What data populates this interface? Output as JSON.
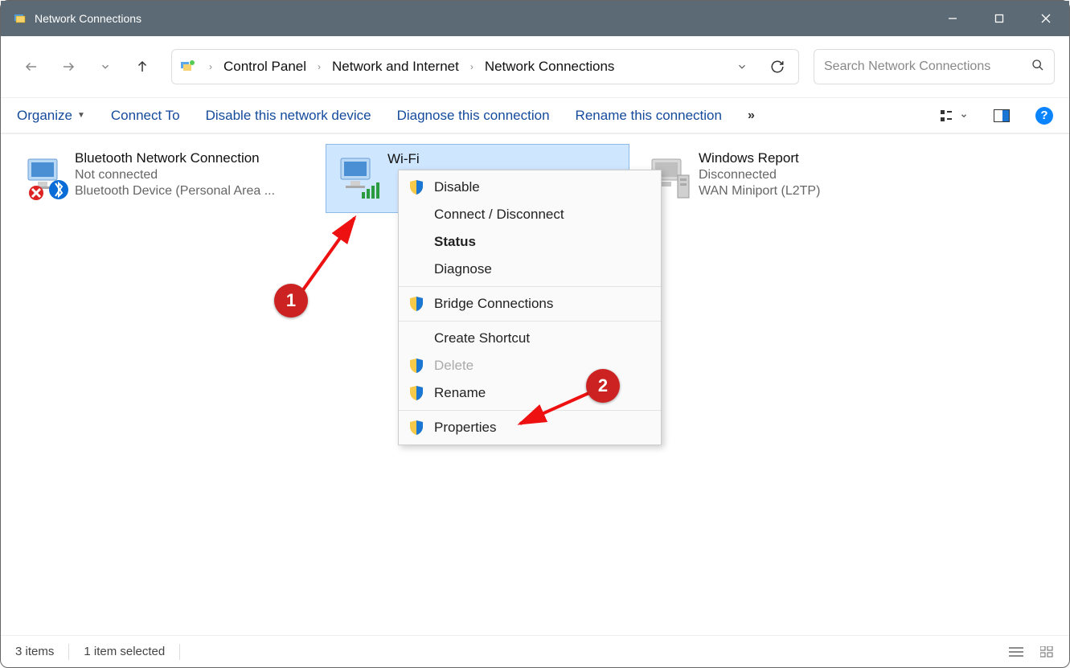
{
  "window": {
    "title": "Network Connections"
  },
  "breadcrumb": {
    "root": "Control Panel",
    "mid": "Network and Internet",
    "leaf": "Network Connections"
  },
  "search": {
    "placeholder": "Search Network Connections"
  },
  "cmd": {
    "organize": "Organize",
    "connect": "Connect To",
    "disable": "Disable this network device",
    "diagnose": "Diagnose this connection",
    "rename": "Rename this connection"
  },
  "items": [
    {
      "name": "Bluetooth Network Connection",
      "status": "Not connected",
      "device": "Bluetooth Device (Personal Area ..."
    },
    {
      "name": "Wi-Fi",
      "status": "",
      "device": ""
    },
    {
      "name": "Windows Report",
      "status": "Disconnected",
      "device": "WAN Miniport (L2TP)"
    }
  ],
  "menu": {
    "disable": "Disable",
    "connect": "Connect / Disconnect",
    "status": "Status",
    "diagnose": "Diagnose",
    "bridge": "Bridge Connections",
    "shortcut": "Create Shortcut",
    "delete": "Delete",
    "rename": "Rename",
    "properties": "Properties"
  },
  "annotations": {
    "1": "1",
    "2": "2"
  },
  "status": {
    "count": "3 items",
    "selected": "1 item selected"
  }
}
